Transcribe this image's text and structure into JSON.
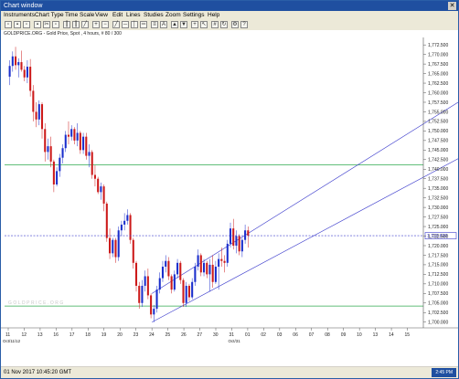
{
  "window": {
    "title": "Chart window"
  },
  "menu": [
    "Instruments",
    "Chart Type",
    "Time Scale",
    "View",
    "Edit",
    "Lines",
    "Studies",
    "Zoom",
    "Settings",
    "Help"
  ],
  "instrument_info": "GOLDPRICE.ORG - Gold Price, Spot , 4 hours, # 80 / 300",
  "watermark": "GOLDPRICE.ORG",
  "status": {
    "datetime": "01 Nov 2017 10:45:20 GMT",
    "badge": "2:45 PM"
  },
  "colors": {
    "up": "#1a2ecc",
    "down": "#cc1a1a",
    "channel": "#3b3bcc",
    "horizontal": "#2fa84f",
    "current_price_line": "#3b3bcc"
  },
  "chart_data": {
    "type": "candlestick",
    "title": "",
    "xlabel": "",
    "ylabel": "",
    "x_ticks": [
      "11",
      "12",
      "13",
      "16",
      "17",
      "18",
      "19",
      "20",
      "23",
      "24",
      "25",
      "26",
      "27",
      "30",
      "31",
      "01",
      "02",
      "03",
      "06",
      "07",
      "08",
      "09",
      "10",
      "13",
      "14",
      "15"
    ],
    "x_subtick": "Oct/31",
    "x_start_label": "Oct/11/12",
    "y_ticks": [
      "1,772.500",
      "1,770.000",
      "1,767.500",
      "1,765.000",
      "1,762.500",
      "1,760.000",
      "1,757.500",
      "1,755.000",
      "1,752.500",
      "1,750.000",
      "1,747.500",
      "1,745.000",
      "1,742.500",
      "1,740.000",
      "1,737.500",
      "1,735.000",
      "1,732.500",
      "1,730.000",
      "1,727.500",
      "1,725.000",
      "1,722.500",
      "1,720.000",
      "1,717.500",
      "1,715.000",
      "1,712.500",
      "1,710.000",
      "1,707.500",
      "1,705.000",
      "1,702.500",
      "1,700.000"
    ],
    "ylim": [
      1698.5,
      1773.5
    ],
    "current_price": "1,722.600",
    "horizontal_lines": [
      1741.1,
      1704.2
    ],
    "channel_upper": [
      {
        "x": "24",
        "y": 1707.5
      },
      {
        "x": "15+",
        "y": 1757.8
      }
    ],
    "channel_lower": [
      {
        "x": "24",
        "y": 1700.0
      },
      {
        "x": "15+",
        "y": 1743.0
      }
    ],
    "candles": [
      [
        1764.2,
        1768.5,
        1762.0,
        1767.0
      ],
      [
        1767.0,
        1770.8,
        1765.5,
        1769.5
      ],
      [
        1769.5,
        1772.0,
        1766.0,
        1767.2
      ],
      [
        1767.2,
        1769.0,
        1764.0,
        1768.0
      ],
      [
        1768.0,
        1771.0,
        1765.5,
        1766.0
      ],
      [
        1766.0,
        1767.0,
        1763.0,
        1764.0
      ],
      [
        1764.0,
        1768.5,
        1762.5,
        1766.8
      ],
      [
        1766.8,
        1768.8,
        1759.0,
        1760.5
      ],
      [
        1760.5,
        1762.0,
        1752.5,
        1755.0
      ],
      [
        1755.0,
        1757.5,
        1751.0,
        1753.0
      ],
      [
        1753.0,
        1758.0,
        1751.5,
        1757.0
      ],
      [
        1757.0,
        1757.5,
        1748.0,
        1750.5
      ],
      [
        1750.5,
        1752.0,
        1742.0,
        1744.5
      ],
      [
        1744.5,
        1748.0,
        1742.5,
        1746.0
      ],
      [
        1746.0,
        1748.5,
        1740.5,
        1742.0
      ],
      [
        1742.0,
        1742.5,
        1734.0,
        1736.0
      ],
      [
        1736.0,
        1740.5,
        1735.5,
        1739.5
      ],
      [
        1739.5,
        1744.0,
        1738.0,
        1743.0
      ],
      [
        1743.0,
        1746.5,
        1741.5,
        1745.5
      ],
      [
        1745.5,
        1750.0,
        1744.5,
        1749.0
      ],
      [
        1749.0,
        1752.5,
        1746.5,
        1748.5
      ],
      [
        1748.5,
        1751.5,
        1747.5,
        1750.5
      ],
      [
        1750.5,
        1751.0,
        1746.5,
        1747.5
      ],
      [
        1747.5,
        1752.0,
        1746.0,
        1749.5
      ],
      [
        1749.5,
        1750.0,
        1744.0,
        1745.0
      ],
      [
        1745.0,
        1749.5,
        1744.0,
        1748.5
      ],
      [
        1748.5,
        1749.5,
        1742.5,
        1743.5
      ],
      [
        1743.5,
        1746.5,
        1740.5,
        1744.5
      ],
      [
        1744.5,
        1745.0,
        1737.5,
        1738.5
      ],
      [
        1738.5,
        1741.0,
        1735.5,
        1737.5
      ],
      [
        1737.5,
        1738.0,
        1733.5,
        1734.0
      ],
      [
        1734.0,
        1736.5,
        1732.0,
        1735.5
      ],
      [
        1735.5,
        1736.0,
        1729.0,
        1731.0
      ],
      [
        1731.0,
        1731.5,
        1721.0,
        1722.0
      ],
      [
        1722.0,
        1724.5,
        1716.5,
        1718.0
      ],
      [
        1718.0,
        1722.0,
        1717.0,
        1721.5
      ],
      [
        1721.5,
        1722.0,
        1715.5,
        1717.0
      ],
      [
        1717.0,
        1725.0,
        1716.0,
        1724.0
      ],
      [
        1724.0,
        1726.5,
        1722.5,
        1725.5
      ],
      [
        1725.5,
        1728.5,
        1724.0,
        1726.5
      ],
      [
        1726.5,
        1729.5,
        1725.5,
        1728.0
      ],
      [
        1728.0,
        1728.5,
        1720.5,
        1721.5
      ],
      [
        1721.5,
        1722.0,
        1714.0,
        1715.5
      ],
      [
        1715.5,
        1716.0,
        1708.0,
        1709.5
      ],
      [
        1709.5,
        1710.5,
        1703.5,
        1705.0
      ],
      [
        1705.0,
        1711.0,
        1704.0,
        1709.5
      ],
      [
        1709.5,
        1713.5,
        1708.0,
        1712.0
      ],
      [
        1712.0,
        1714.0,
        1706.0,
        1707.0
      ],
      [
        1707.0,
        1707.5,
        1701.0,
        1702.0
      ],
      [
        1702.0,
        1704.5,
        1700.0,
        1703.5
      ],
      [
        1703.5,
        1709.5,
        1702.5,
        1708.5
      ],
      [
        1708.5,
        1713.0,
        1707.5,
        1711.5
      ],
      [
        1711.5,
        1716.0,
        1710.5,
        1714.5
      ],
      [
        1714.5,
        1717.5,
        1713.0,
        1716.0
      ],
      [
        1716.0,
        1717.0,
        1711.0,
        1712.0
      ],
      [
        1712.0,
        1712.5,
        1707.5,
        1708.5
      ],
      [
        1708.5,
        1713.5,
        1708.0,
        1712.5
      ],
      [
        1712.5,
        1716.5,
        1711.5,
        1715.5
      ],
      [
        1715.5,
        1716.0,
        1710.0,
        1711.0
      ],
      [
        1711.0,
        1711.5,
        1704.0,
        1705.0
      ],
      [
        1705.0,
        1710.5,
        1704.0,
        1709.5
      ],
      [
        1709.5,
        1710.0,
        1705.5,
        1706.5
      ],
      [
        1706.5,
        1711.5,
        1706.0,
        1710.5
      ],
      [
        1710.5,
        1715.5,
        1709.5,
        1714.5
      ],
      [
        1714.5,
        1719.0,
        1713.5,
        1717.5
      ],
      [
        1717.5,
        1718.0,
        1712.0,
        1713.0
      ],
      [
        1713.0,
        1716.5,
        1712.0,
        1715.5
      ],
      [
        1715.5,
        1716.0,
        1711.5,
        1712.5
      ],
      [
        1712.5,
        1716.5,
        1708.0,
        1715.0
      ],
      [
        1715.0,
        1717.5,
        1709.0,
        1710.5
      ],
      [
        1710.5,
        1716.0,
        1710.0,
        1714.5
      ],
      [
        1714.5,
        1718.0,
        1708.5,
        1716.5
      ],
      [
        1716.5,
        1719.5,
        1714.5,
        1716.0
      ],
      [
        1716.0,
        1717.5,
        1713.0,
        1715.5
      ],
      [
        1715.5,
        1721.5,
        1714.5,
        1720.5
      ],
      [
        1720.5,
        1726.0,
        1719.5,
        1724.5
      ],
      [
        1724.5,
        1727.0,
        1719.0,
        1720.0
      ],
      [
        1720.0,
        1724.0,
        1718.0,
        1722.5
      ],
      [
        1722.5,
        1723.0,
        1717.5,
        1718.5
      ],
      [
        1718.5,
        1722.0,
        1717.0,
        1721.5
      ],
      [
        1721.5,
        1725.5,
        1720.5,
        1724.0
      ],
      [
        1724.0,
        1725.0,
        1719.5,
        1722.6
      ]
    ]
  }
}
